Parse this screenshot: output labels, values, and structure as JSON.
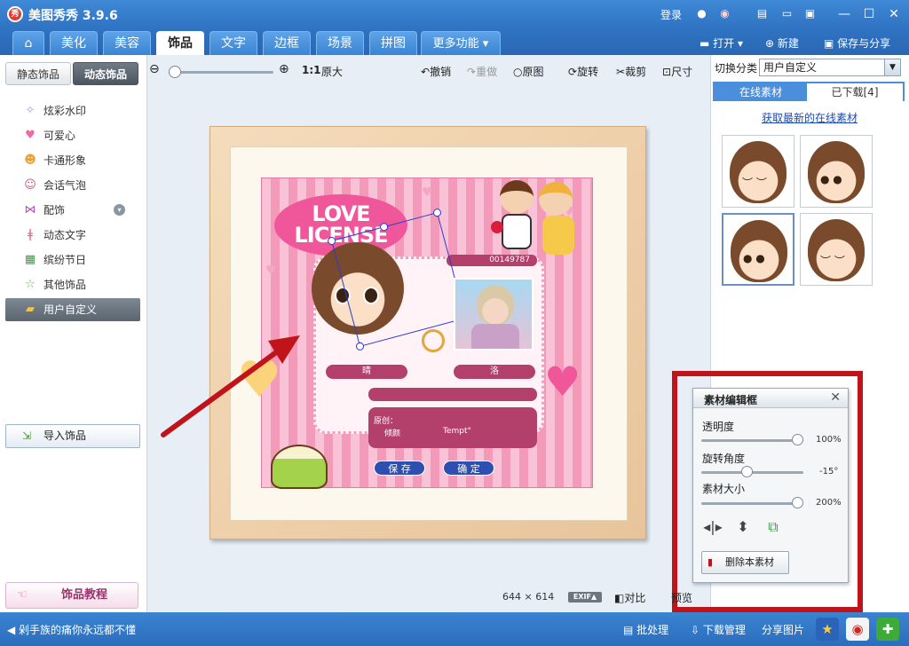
{
  "window": {
    "app_title": "美图秀秀 3.9.6",
    "logo_text": "秀",
    "login": "登录"
  },
  "tabs": [
    {
      "label": "美化"
    },
    {
      "label": "美容"
    },
    {
      "label": "饰品"
    },
    {
      "label": "文字"
    },
    {
      "label": "边框"
    },
    {
      "label": "场景"
    },
    {
      "label": "拼图"
    },
    {
      "label": "更多功能 ▾"
    }
  ],
  "top_actions": {
    "open": "打开",
    "new": "新建",
    "save_share": "保存与分享"
  },
  "left_panel": {
    "subtabs": [
      "静态饰品",
      "动态饰品"
    ],
    "categories": [
      {
        "label": "炫彩水印"
      },
      {
        "label": "可爱心"
      },
      {
        "label": "卡通形象"
      },
      {
        "label": "会话气泡"
      },
      {
        "label": "配饰"
      },
      {
        "label": "动态文字"
      },
      {
        "label": "缤纷节日"
      },
      {
        "label": "其他饰品"
      },
      {
        "label": "用户自定义"
      }
    ],
    "import_label": "导入饰品",
    "tutorial_label": "饰品教程"
  },
  "toolbar": {
    "ratio": "1:1",
    "original_size": "原大",
    "undo": "撤销",
    "redo": "重做",
    "original": "原图",
    "rotate": "旋转",
    "crop": "裁剪",
    "resize": "尺寸",
    "zoom_level": 0.0
  },
  "canvas": {
    "license_title": "LOVE LICENSE",
    "license_number": "00149787",
    "name_left": "晴",
    "name_right": "洛",
    "field_label": "原创：",
    "field_text1": "倾颜",
    "field_text2": "Tempt°",
    "save_btn": "保 存",
    "ok_btn": "确 定",
    "size_w": "644",
    "size_x": "×",
    "size_h": "614",
    "exif": "EXIF▲",
    "compare": "对比",
    "preview": "预览"
  },
  "right_panel": {
    "switch_label": "切换分类",
    "switch_value": "用户自定义",
    "tab_online": "在线素材",
    "tab_downloaded": "已下载[4]",
    "fetch_link": "获取最新的在线素材",
    "thumbnails": [
      {
        "expression": "smile"
      },
      {
        "expression": "neutral"
      },
      {
        "expression": "neutral",
        "selected": true
      },
      {
        "expression": "smile"
      }
    ]
  },
  "editor": {
    "title": "素材编辑框",
    "opacity_label": "透明度",
    "opacity_value": "100%",
    "opacity_level": 1.0,
    "rotate_label": "旋转角度",
    "rotate_value": "-15°",
    "rotate_level": 0.44,
    "size_label": "素材大小",
    "size_value": "200%",
    "size_level": 1.0,
    "delete_label": "删除本素材"
  },
  "statusbar": {
    "text": "剁手族的痛你永远都不懂",
    "batch": "批处理",
    "download": "下载管理",
    "share": "分享图片"
  },
  "colors": {
    "accent_blue": "#2f73c2",
    "highlight_red": "#c0141a",
    "license_pink": "#f0579a"
  }
}
